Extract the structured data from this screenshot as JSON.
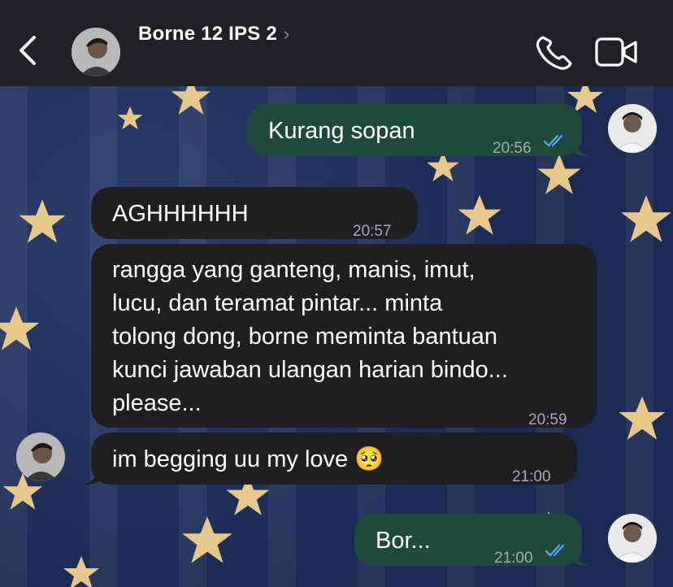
{
  "header": {
    "back_icon": "chevron-left-icon",
    "contact_name": "Borne 12 IPS 2",
    "chevron": "›",
    "call_icon": "phone-icon",
    "video_icon": "video-camera-icon"
  },
  "messages": [
    {
      "direction": "outgoing",
      "text": "Kurang sopan",
      "time": "20:56",
      "status": "read"
    },
    {
      "direction": "incoming",
      "text": "AGHHHHHH",
      "time": "20:57"
    },
    {
      "direction": "incoming",
      "lines": [
        "rangga yang ganteng, manis, imut,",
        "lucu, dan teramat pintar... minta",
        "tolong dong, borne meminta bantuan",
        "kunci jawaban ulangan harian bindo...",
        "please..."
      ],
      "time": "20:59"
    },
    {
      "direction": "incoming",
      "text": "im begging uu my love 🥺",
      "time": "21:00"
    },
    {
      "direction": "outgoing",
      "text": "Bor...",
      "time": "21:00",
      "status": "read"
    }
  ],
  "colors": {
    "header_bg": "#202124",
    "outgoing_bubble": "#1f4a3b",
    "incoming_bubble": "#1f1f21",
    "read_ticks": "#4fa3f7",
    "wallpaper": "#1d2c55",
    "star": "#e6c98a"
  }
}
